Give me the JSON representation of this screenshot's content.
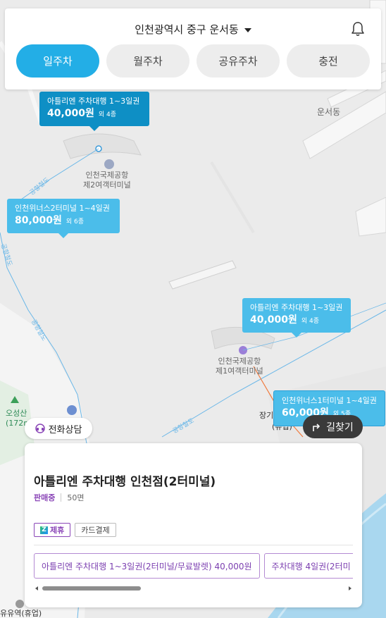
{
  "header": {
    "location": "인천광역시 중구 운서동",
    "tabs": [
      {
        "label": "일주차",
        "active": true
      },
      {
        "label": "월주차",
        "active": false
      },
      {
        "label": "공유주차",
        "active": false
      },
      {
        "label": "충전",
        "active": false
      }
    ]
  },
  "map": {
    "labels": {
      "terminal2": "인천국제공항\n제2여객터미널",
      "terminal1": "인천국제공항\n제1여객터미널",
      "unseo": "운서동",
      "osungsan": "오성산\n(172m",
      "jangi": "장기",
      "yucheop": "(유입)",
      "bottom_left": "유유역(휴업)",
      "rail_1": "공항철도",
      "rail_2": "공항철도",
      "rail_3": "공항철도",
      "rail_4": "공항철도"
    },
    "markers": [
      {
        "title": "아틀리엔 주차대행 1~3일권",
        "price": "40,000원",
        "count": "외 4종",
        "style": "dark"
      },
      {
        "title": "인천위너스2터미널 1~4일권",
        "price": "80,000원",
        "count": "외 6종",
        "style": "light"
      },
      {
        "title": "아틀리엔 주차대행 1~3일권",
        "price": "40,000원",
        "count": "외 4종",
        "style": "light"
      },
      {
        "title": "인천위너스1터미널 1~4일권",
        "price": "60,000원",
        "count": "외 5종",
        "style": "light"
      }
    ]
  },
  "buttons": {
    "phone": "전화상담",
    "directions": "길찾기"
  },
  "card": {
    "title": "아틀리엔 주차대행 인천점(2터미널)",
    "status": "판매중",
    "spaces": "50면",
    "tags": [
      "제휴",
      "카드결제"
    ],
    "products": [
      "아틀리엔 주차대행 1~3일권(2터미널/무료발렛) 40,000원",
      "주차대행 4일권(2터미"
    ]
  },
  "colors": {
    "accent": "#23aee6",
    "marker_dark": "#0e8fc5",
    "marker_light": "#4bbdea",
    "purple": "#8a45b7"
  }
}
